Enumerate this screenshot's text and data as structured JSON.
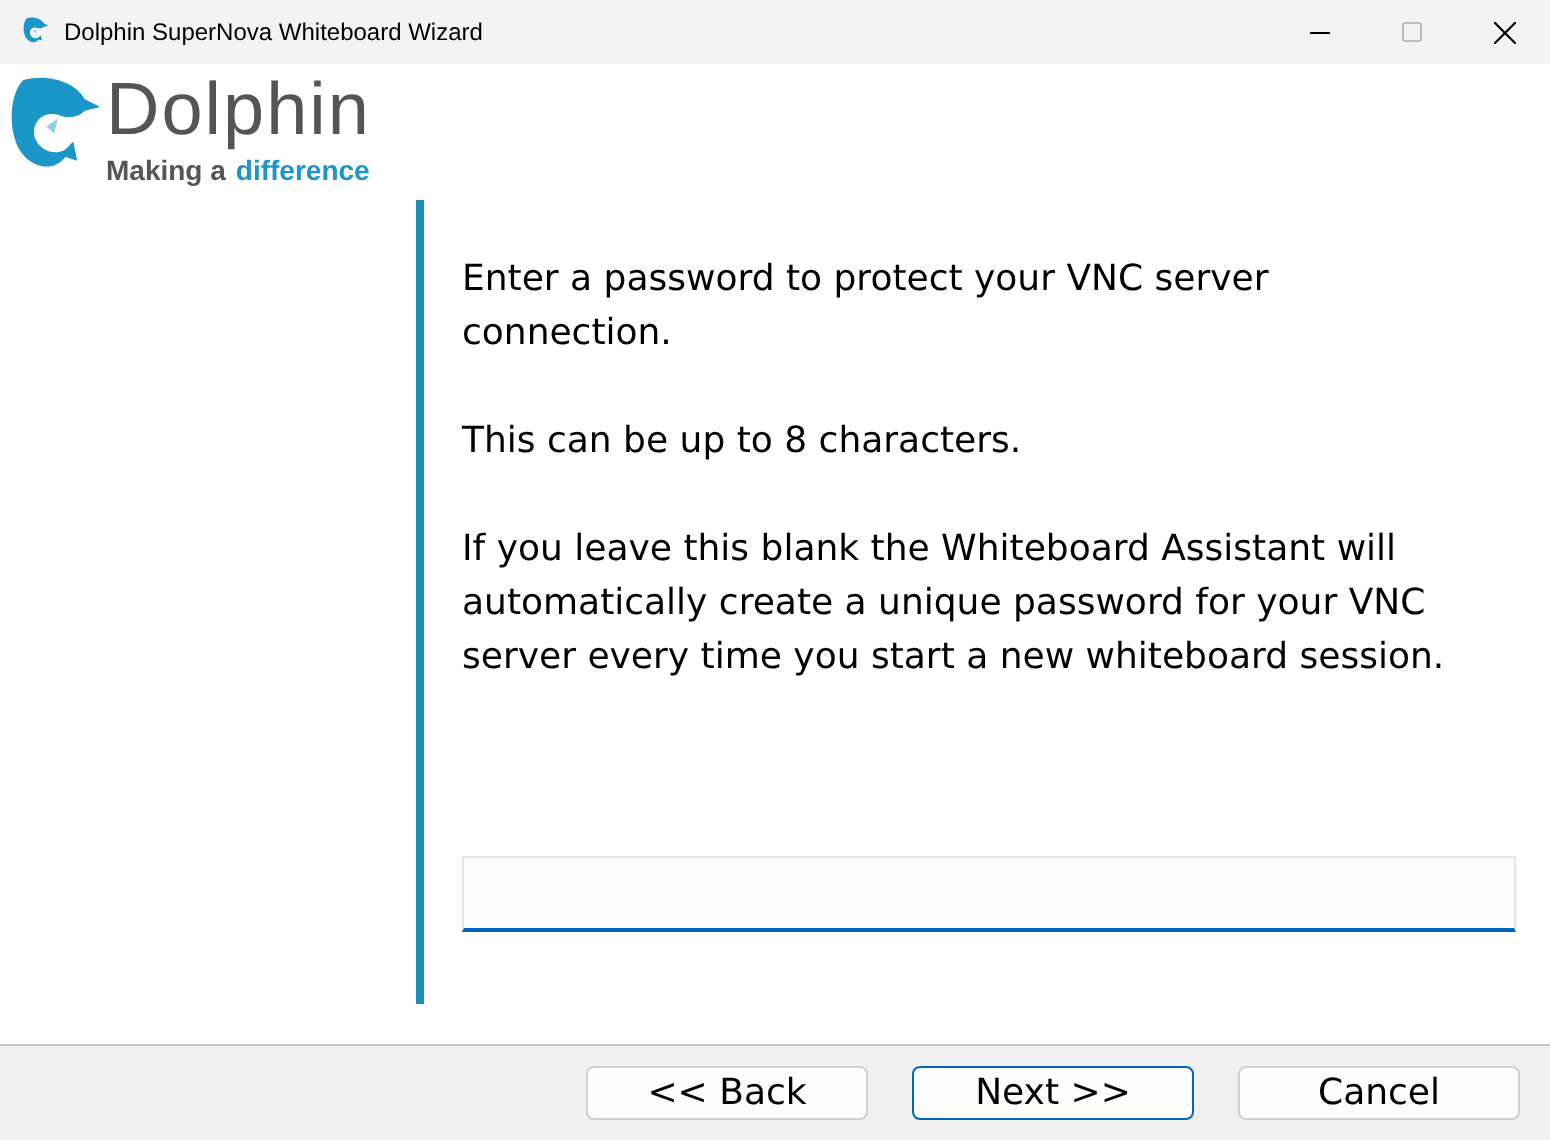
{
  "window": {
    "title": "Dolphin SuperNova Whiteboard Wizard"
  },
  "logo": {
    "name": "Dolphin",
    "tagline_start": "Making a",
    "tagline_highlight": "difference"
  },
  "paragraphs": [
    "Enter a password to protect your VNC server connection.",
    "This can be up to 8 characters.",
    "If you leave this blank the Whiteboard Assistant will automatically create a unique password for your VNC server every time you start a new whiteboard session."
  ],
  "buttons": [
    {
      "label": "<< Back",
      "default": false
    },
    {
      "label": "Next >>",
      "default": true
    },
    {
      "label": "Cancel",
      "default": false
    }
  ]
}
